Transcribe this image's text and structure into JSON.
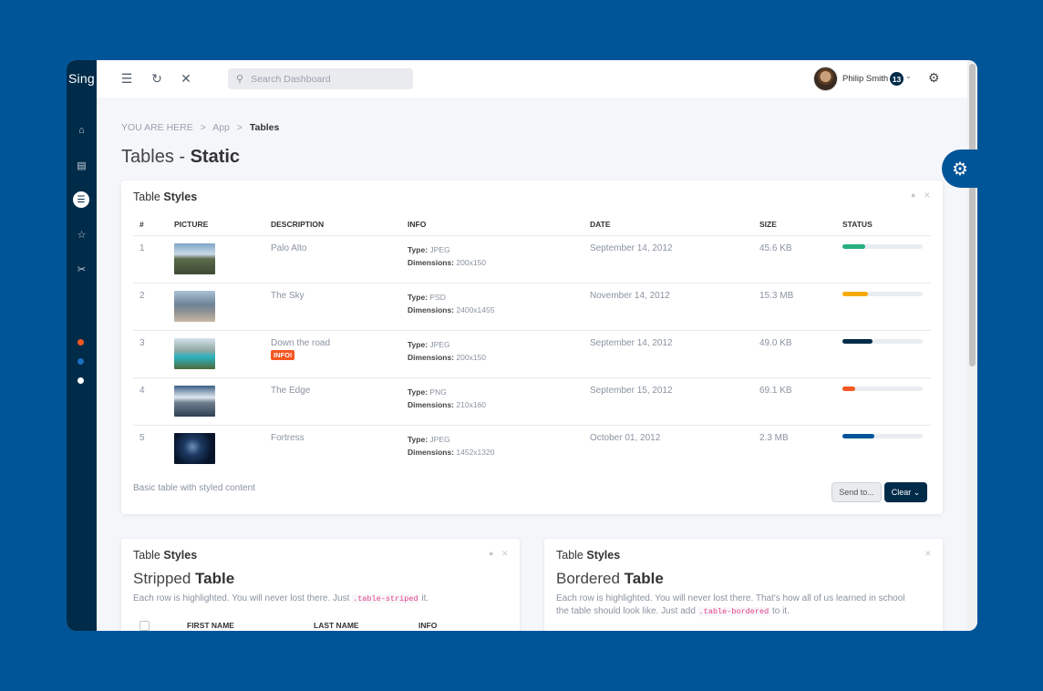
{
  "app": {
    "logo": "Sing"
  },
  "topbar": {
    "search_placeholder": "Search Dashboard",
    "user_name": "Philip Smith",
    "notification_count": "13"
  },
  "breadcrumb": {
    "prefix": "YOU ARE HERE",
    "sep": ">",
    "items": [
      "App",
      "Tables"
    ]
  },
  "page_title": {
    "light": "Tables - ",
    "bold": "Static"
  },
  "table_card": {
    "title_light": "Table ",
    "title_bold": "Styles",
    "columns": [
      "#",
      "PICTURE",
      "DESCRIPTION",
      "INFO",
      "DATE",
      "SIZE",
      "STATUS"
    ],
    "type_label": "Type:",
    "dimensions_label": "Dimensions:",
    "rows": [
      {
        "num": "1",
        "desc": "Palo Alto",
        "type": "JPEG",
        "dims": "200x150",
        "date": "September 14, 2012",
        "size": "45.6 KB",
        "status": 0.28,
        "status_color": "#26b07e",
        "badge": ""
      },
      {
        "num": "2",
        "desc": "The Sky",
        "type": "PSD",
        "dims": "2400x1455",
        "date": "November 14, 2012",
        "size": "15.3 MB",
        "status": 0.32,
        "status_color": "#f5aa09",
        "badge": ""
      },
      {
        "num": "3",
        "desc": "Down the road",
        "type": "JPEG",
        "dims": "200x150",
        "date": "September 14, 2012",
        "size": "49.0 KB",
        "status": 0.38,
        "status_color": "#002b49",
        "badge": "INFO!"
      },
      {
        "num": "4",
        "desc": "The Edge",
        "type": "PNG",
        "dims": "210x160",
        "date": "September 15, 2012",
        "size": "69.1 KB",
        "status": 0.16,
        "status_color": "#f45722",
        "badge": ""
      },
      {
        "num": "5",
        "desc": "Fortress",
        "type": "JPEG",
        "dims": "1452x1320",
        "date": "October 01, 2012",
        "size": "2.3 MB",
        "status": 0.4,
        "status_color": "#005599",
        "badge": ""
      }
    ],
    "footer_text": "Basic table with styled content",
    "send_label": "Send to...",
    "clear_label": "Clear"
  },
  "striped_card": {
    "title_light": "Table ",
    "title_bold": "Styles",
    "sub_light": "Stripped ",
    "sub_bold": "Table",
    "desc_before": "Each row is highlighted. You will never lost there. Just ",
    "desc_code": ".table-striped",
    "desc_after": " it.",
    "columns": [
      "FIRST NAME",
      "LAST NAME",
      "INFO"
    ]
  },
  "bordered_card": {
    "title_light": "Table ",
    "title_bold": "Styles",
    "sub_light": "Bordered ",
    "sub_bold": "Table",
    "desc_line1": "Each row is highlighted. You will never lost there. That's how all of us learned in school",
    "desc_before": "the table should look like. Just add ",
    "desc_code": ".table-bordered",
    "desc_after": " to it."
  },
  "colors": {
    "sidebar": "#002b49",
    "accent": "#005599",
    "danger": "#f45722"
  }
}
